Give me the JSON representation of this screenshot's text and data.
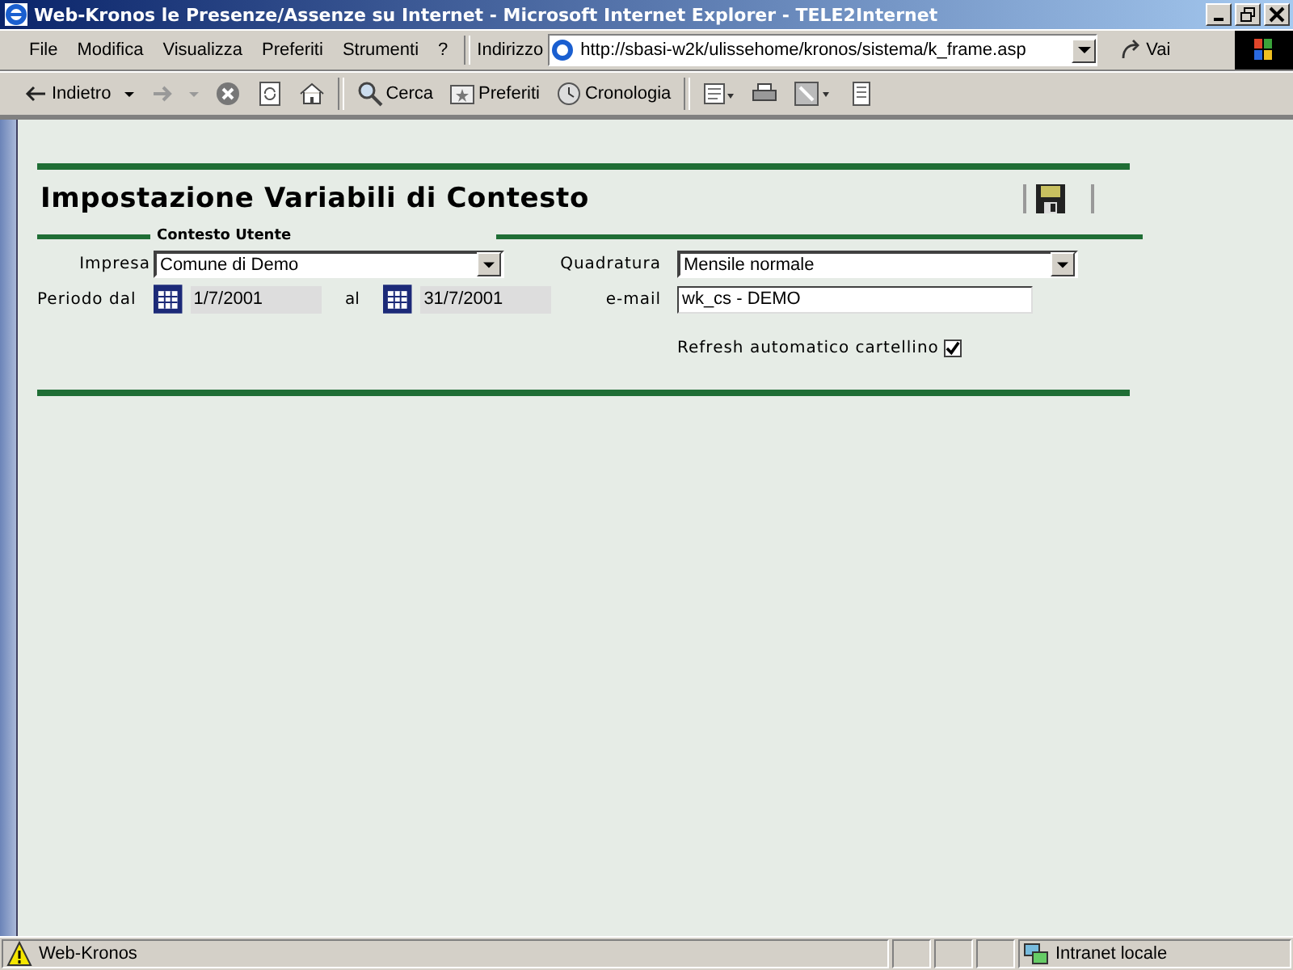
{
  "window": {
    "title": "Web-Kronos le Presenze/Assenze su Internet - Microsoft Internet Explorer - TELE2Internet"
  },
  "menu": [
    "File",
    "Modifica",
    "Visualizza",
    "Preferiti",
    "Strumenti",
    "?"
  ],
  "address": {
    "label": "Indirizzo",
    "value": "http://sbasi-w2k/ulissehome/kronos/sistema/k_frame.asp",
    "go": "Vai"
  },
  "toolbar": [
    {
      "kind": "back",
      "label": "Indietro"
    },
    {
      "kind": "forward"
    },
    {
      "kind": "stop"
    },
    {
      "kind": "refresh"
    },
    {
      "kind": "home"
    },
    {
      "kind": "sep"
    },
    {
      "kind": "search",
      "label": "Cerca"
    },
    {
      "kind": "favorites",
      "label": "Preferiti"
    },
    {
      "kind": "history",
      "label": "Cronologia"
    },
    {
      "kind": "sep"
    },
    {
      "kind": "mail"
    },
    {
      "kind": "print"
    },
    {
      "kind": "edit"
    },
    {
      "kind": "discuss"
    }
  ],
  "page": {
    "title": "Impostazione Variabili di Contesto",
    "section": "Contesto Utente",
    "impresa": {
      "label": "Impresa",
      "value": "Comune di Demo"
    },
    "quadratura": {
      "label": "Quadratura",
      "value": "Mensile normale"
    },
    "periodo": {
      "label": "Periodo dal",
      "from": "1/7/2001",
      "to_label": "al",
      "to": "31/7/2001"
    },
    "email": {
      "label": "e-mail",
      "value": "wk_cs - DEMO"
    },
    "refresh": {
      "label": "Refresh automatico cartellino",
      "checked": true
    }
  },
  "status_bar": {
    "text": "Web-Kronos",
    "zone": "Intranet locale"
  }
}
